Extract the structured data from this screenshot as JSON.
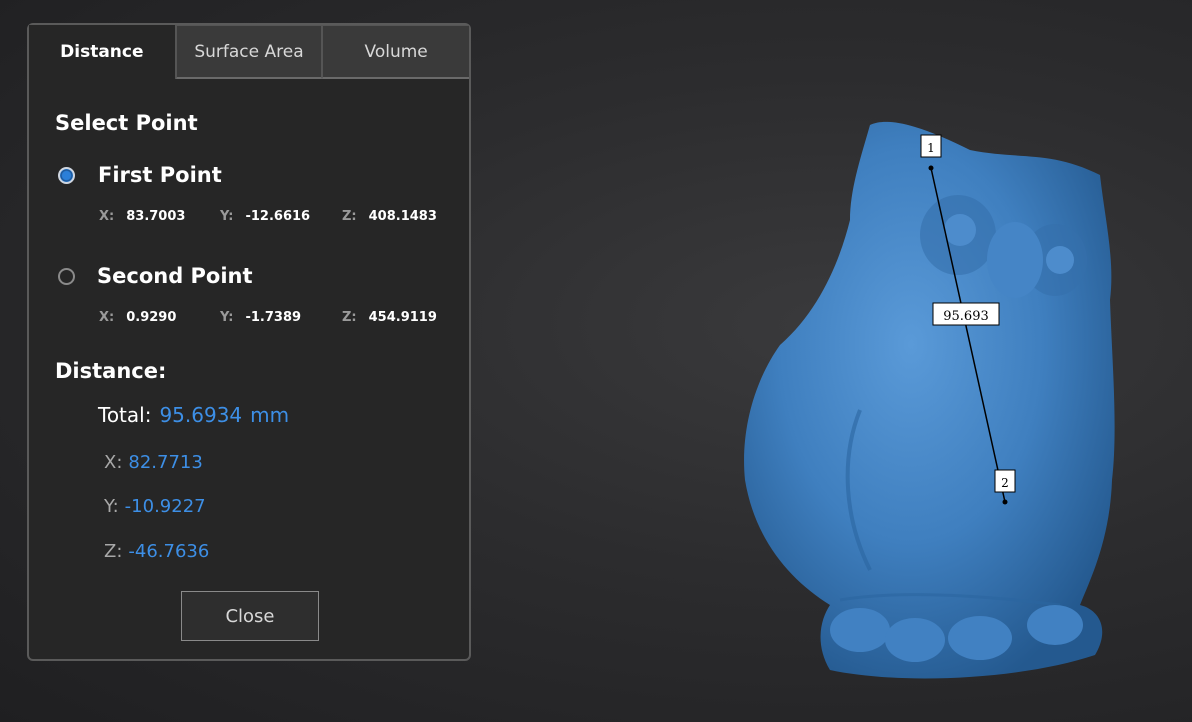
{
  "tabs": [
    {
      "label": "Distance",
      "active": true
    },
    {
      "label": "Surface Area",
      "active": false
    },
    {
      "label": "Volume",
      "active": false
    }
  ],
  "select_point_title": "Select Point",
  "first_point": {
    "label": "First Point",
    "selected": true,
    "x_key": "X:",
    "x": "83.7003",
    "y_key": "Y:",
    "y": "-12.6616",
    "z_key": "Z:",
    "z": "408.1483"
  },
  "second_point": {
    "label": "Second Point",
    "selected": false,
    "x_key": "X:",
    "x": "0.9290",
    "y_key": "Y:",
    "y": "-1.7389",
    "z_key": "Z:",
    "z": "454.9119"
  },
  "distance": {
    "title": "Distance:",
    "total_label": "Total:",
    "total_value": "95.6934",
    "unit": "mm",
    "x_label": "X:",
    "x_value": "82.7713",
    "y_label": "Y:",
    "y_value": "-10.9227",
    "z_label": "Z:",
    "z_value": "-46.7636"
  },
  "close_label": "Close",
  "viewport": {
    "model_color": "#3f7fbf",
    "marker1": "1",
    "marker2": "2",
    "measure_label": "95.693"
  },
  "colors": {
    "accent": "#3d8fe6"
  }
}
